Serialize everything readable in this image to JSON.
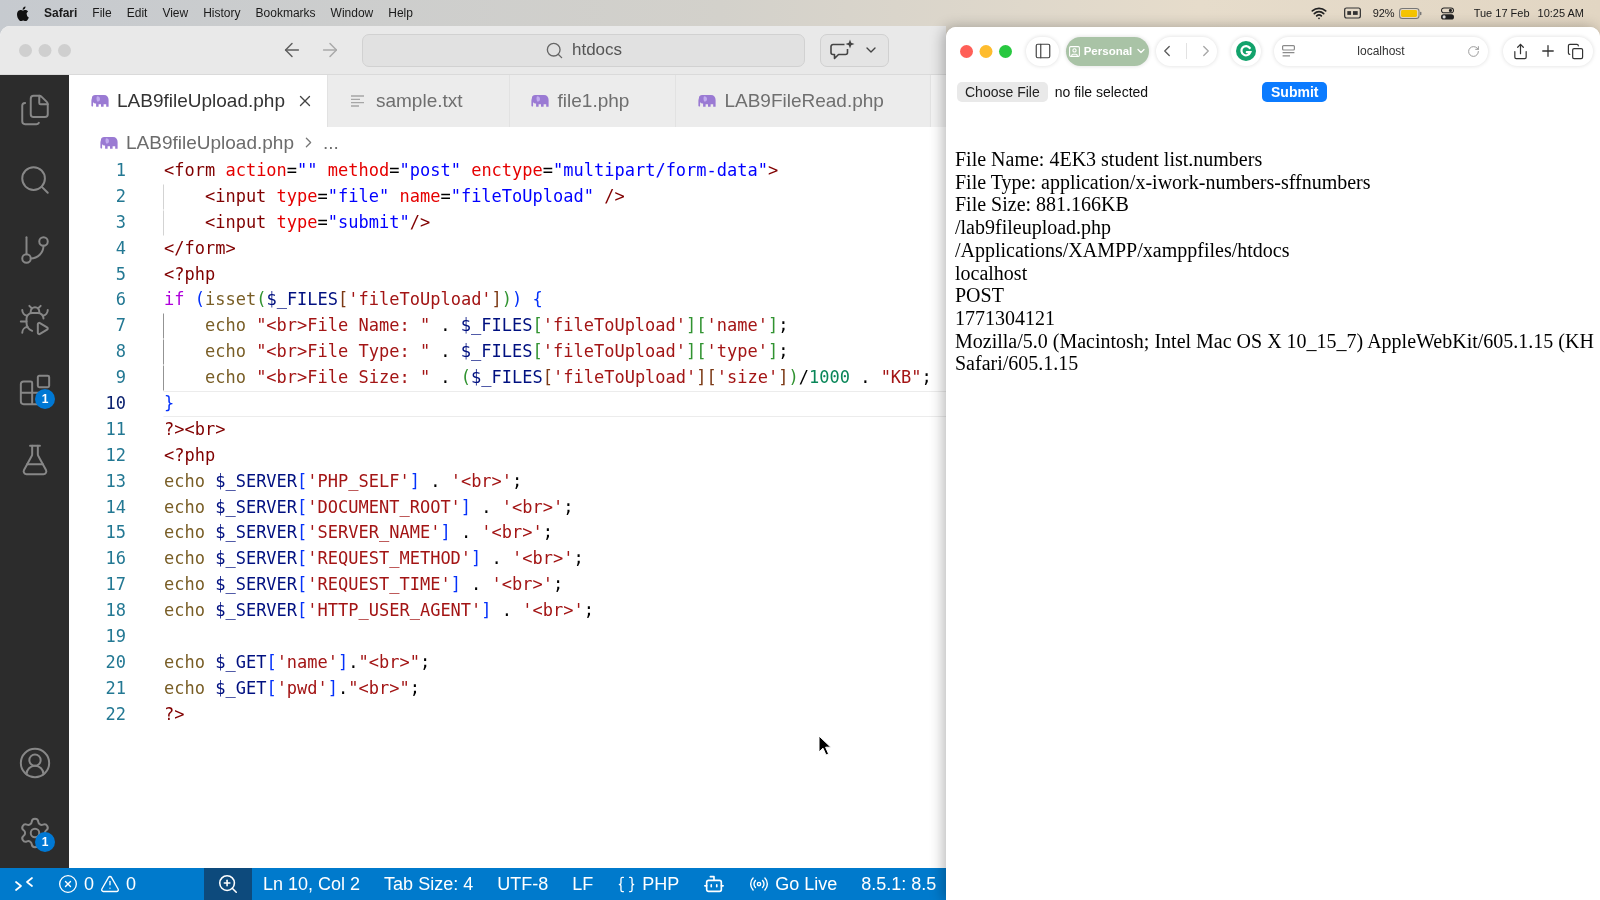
{
  "menu_bar": {
    "app_name": "Safari",
    "menus": [
      "File",
      "Edit",
      "View",
      "History",
      "Bookmarks",
      "Window",
      "Help"
    ],
    "battery_percent": "92%",
    "date": "Tue 17 Feb",
    "time": "10:25 AM"
  },
  "editor_window": {
    "active": false,
    "navigation": [
      {
        "kind": "back",
        "disabled": false
      },
      {
        "kind": "forward",
        "disabled": true
      }
    ],
    "command_center": {
      "label": "htdocs"
    },
    "activity_bar": {
      "top": [
        {
          "kind": "files"
        },
        {
          "kind": "search"
        },
        {
          "kind": "source-control"
        },
        {
          "kind": "run-debug"
        },
        {
          "kind": "extensions",
          "badge": "1"
        },
        {
          "kind": "testing"
        }
      ],
      "bottom": [
        {
          "kind": "account"
        },
        {
          "kind": "settings",
          "badge": "1"
        }
      ]
    },
    "tabs": [
      {
        "label": "LAB9fileUpload.php",
        "kind": "php",
        "selected": true
      },
      {
        "label": "sample.txt",
        "kind": "text",
        "selected": false
      },
      {
        "label": "file1.php",
        "kind": "php",
        "selected": false
      },
      {
        "label": "LAB9FileRead.php",
        "kind": "php",
        "selected": false
      }
    ],
    "breadcrumb": {
      "file": "LAB9fileUpload.php",
      "rest": "..."
    },
    "code_lines": [
      {
        "number": "1",
        "current": false,
        "guide": false,
        "tokens": [
          {
            "kind": "tag",
            "text": "<form"
          },
          {
            "kind": "attr",
            "text": " action"
          },
          {
            "kind": "plain",
            "text": "="
          },
          {
            "kind": "value",
            "text": "\"\""
          },
          {
            "kind": "attr",
            "text": " method"
          },
          {
            "kind": "plain",
            "text": "="
          },
          {
            "kind": "value",
            "text": "\"post\""
          },
          {
            "kind": "attr",
            "text": " enctype"
          },
          {
            "kind": "plain",
            "text": "="
          },
          {
            "kind": "value",
            "text": "\"multipart/form-data\""
          },
          {
            "kind": "tag",
            "text": ">"
          }
        ]
      },
      {
        "number": "2",
        "current": false,
        "guide": true,
        "guide_active": false,
        "tokens": [
          {
            "kind": "tag",
            "text": "    <input"
          },
          {
            "kind": "attr",
            "text": " type"
          },
          {
            "kind": "plain",
            "text": "="
          },
          {
            "kind": "value",
            "text": "\"file\""
          },
          {
            "kind": "attr",
            "text": " name"
          },
          {
            "kind": "plain",
            "text": "="
          },
          {
            "kind": "value",
            "text": "\"fileToUpload\""
          },
          {
            "kind": "tag",
            "text": " />"
          }
        ]
      },
      {
        "number": "3",
        "current": false,
        "guide": true,
        "guide_active": false,
        "tokens": [
          {
            "kind": "tag",
            "text": "    <input"
          },
          {
            "kind": "attr",
            "text": " type"
          },
          {
            "kind": "plain",
            "text": "="
          },
          {
            "kind": "value",
            "text": "\"submit\""
          },
          {
            "kind": "tag",
            "text": "/>"
          }
        ]
      },
      {
        "number": "4",
        "current": false,
        "guide": false,
        "tokens": [
          {
            "kind": "tag",
            "text": "</form>"
          }
        ]
      },
      {
        "number": "5",
        "current": false,
        "guide": false,
        "tokens": [
          {
            "kind": "tag",
            "text": "<?php"
          }
        ]
      },
      {
        "number": "6",
        "current": false,
        "guide": false,
        "tokens": [
          {
            "kind": "keyword",
            "text": "if "
          },
          {
            "kind": "bracket1",
            "text": "("
          },
          {
            "kind": "function",
            "text": "isset"
          },
          {
            "kind": "bracket2",
            "text": "("
          },
          {
            "kind": "variable",
            "text": "$_FILES"
          },
          {
            "kind": "bracket3",
            "text": "["
          },
          {
            "kind": "string",
            "text": "'fileToUpload'"
          },
          {
            "kind": "bracket3",
            "text": "]"
          },
          {
            "kind": "bracket2",
            "text": ")"
          },
          {
            "kind": "bracket1",
            "text": ") {"
          }
        ]
      },
      {
        "number": "7",
        "current": false,
        "guide": true,
        "guide_active": true,
        "tokens": [
          {
            "kind": "function",
            "text": "    echo "
          },
          {
            "kind": "string",
            "text": "\"<br>File Name: \""
          },
          {
            "kind": "plain",
            "text": " . "
          },
          {
            "kind": "variable",
            "text": "$_FILES"
          },
          {
            "kind": "bracket2",
            "text": "["
          },
          {
            "kind": "string",
            "text": "'fileToUpload'"
          },
          {
            "kind": "bracket2",
            "text": "]["
          },
          {
            "kind": "string",
            "text": "'name'"
          },
          {
            "kind": "bracket2",
            "text": "]"
          },
          {
            "kind": "plain",
            "text": ";"
          }
        ]
      },
      {
        "number": "8",
        "current": false,
        "guide": true,
        "guide_active": true,
        "tokens": [
          {
            "kind": "function",
            "text": "    echo "
          },
          {
            "kind": "string",
            "text": "\"<br>File Type: \""
          },
          {
            "kind": "plain",
            "text": " . "
          },
          {
            "kind": "variable",
            "text": "$_FILES"
          },
          {
            "kind": "bracket2",
            "text": "["
          },
          {
            "kind": "string",
            "text": "'fileToUpload'"
          },
          {
            "kind": "bracket2",
            "text": "]["
          },
          {
            "kind": "string",
            "text": "'type'"
          },
          {
            "kind": "bracket2",
            "text": "]"
          },
          {
            "kind": "plain",
            "text": ";"
          }
        ]
      },
      {
        "number": "9",
        "current": false,
        "guide": true,
        "guide_active": true,
        "tokens": [
          {
            "kind": "function",
            "text": "    echo "
          },
          {
            "kind": "string",
            "text": "\"<br>File Size: \""
          },
          {
            "kind": "plain",
            "text": " . "
          },
          {
            "kind": "bracket2",
            "text": "("
          },
          {
            "kind": "variable",
            "text": "$_FILES"
          },
          {
            "kind": "bracket3",
            "text": "["
          },
          {
            "kind": "string",
            "text": "'fileToUpload'"
          },
          {
            "kind": "bracket3",
            "text": "]["
          },
          {
            "kind": "string",
            "text": "'size'"
          },
          {
            "kind": "bracket3",
            "text": "]"
          },
          {
            "kind": "bracket2",
            "text": ")"
          },
          {
            "kind": "plain",
            "text": "/"
          },
          {
            "kind": "number",
            "text": "1000"
          },
          {
            "kind": "plain",
            "text": " . "
          },
          {
            "kind": "string",
            "text": "\"KB\""
          },
          {
            "kind": "plain",
            "text": ";"
          }
        ]
      },
      {
        "number": "10",
        "current": true,
        "guide": false,
        "tokens": [
          {
            "kind": "bracket1",
            "text": "}"
          }
        ]
      },
      {
        "number": "11",
        "current": false,
        "guide": false,
        "tokens": [
          {
            "kind": "tag",
            "text": "?><br>"
          }
        ]
      },
      {
        "number": "12",
        "current": false,
        "guide": false,
        "tokens": [
          {
            "kind": "tag",
            "text": "<?php"
          }
        ]
      },
      {
        "number": "13",
        "current": false,
        "guide": false,
        "tokens": [
          {
            "kind": "function",
            "text": "echo "
          },
          {
            "kind": "variable",
            "text": "$_SERVER"
          },
          {
            "kind": "bracket1",
            "text": "["
          },
          {
            "kind": "string",
            "text": "'PHP_SELF'"
          },
          {
            "kind": "bracket1",
            "text": "]"
          },
          {
            "kind": "plain",
            "text": " . "
          },
          {
            "kind": "string",
            "text": "'<br>'"
          },
          {
            "kind": "plain",
            "text": ";"
          }
        ]
      },
      {
        "number": "14",
        "current": false,
        "guide": false,
        "tokens": [
          {
            "kind": "function",
            "text": "echo "
          },
          {
            "kind": "variable",
            "text": "$_SERVER"
          },
          {
            "kind": "bracket1",
            "text": "["
          },
          {
            "kind": "string",
            "text": "'DOCUMENT_ROOT'"
          },
          {
            "kind": "bracket1",
            "text": "]"
          },
          {
            "kind": "plain",
            "text": " . "
          },
          {
            "kind": "string",
            "text": "'<br>'"
          },
          {
            "kind": "plain",
            "text": ";"
          }
        ]
      },
      {
        "number": "15",
        "current": false,
        "guide": false,
        "tokens": [
          {
            "kind": "function",
            "text": "echo "
          },
          {
            "kind": "variable",
            "text": "$_SERVER"
          },
          {
            "kind": "bracket1",
            "text": "["
          },
          {
            "kind": "string",
            "text": "'SERVER_NAME'"
          },
          {
            "kind": "bracket1",
            "text": "]"
          },
          {
            "kind": "plain",
            "text": " . "
          },
          {
            "kind": "string",
            "text": "'<br>'"
          },
          {
            "kind": "plain",
            "text": ";"
          }
        ]
      },
      {
        "number": "16",
        "current": false,
        "guide": false,
        "tokens": [
          {
            "kind": "function",
            "text": "echo "
          },
          {
            "kind": "variable",
            "text": "$_SERVER"
          },
          {
            "kind": "bracket1",
            "text": "["
          },
          {
            "kind": "string",
            "text": "'REQUEST_METHOD'"
          },
          {
            "kind": "bracket1",
            "text": "]"
          },
          {
            "kind": "plain",
            "text": " . "
          },
          {
            "kind": "string",
            "text": "'<br>'"
          },
          {
            "kind": "plain",
            "text": ";"
          }
        ]
      },
      {
        "number": "17",
        "current": false,
        "guide": false,
        "tokens": [
          {
            "kind": "function",
            "text": "echo "
          },
          {
            "kind": "variable",
            "text": "$_SERVER"
          },
          {
            "kind": "bracket1",
            "text": "["
          },
          {
            "kind": "string",
            "text": "'REQUEST_TIME'"
          },
          {
            "kind": "bracket1",
            "text": "]"
          },
          {
            "kind": "plain",
            "text": " . "
          },
          {
            "kind": "string",
            "text": "'<br>'"
          },
          {
            "kind": "plain",
            "text": ";"
          }
        ]
      },
      {
        "number": "18",
        "current": false,
        "guide": false,
        "tokens": [
          {
            "kind": "function",
            "text": "echo "
          },
          {
            "kind": "variable",
            "text": "$_SERVER"
          },
          {
            "kind": "bracket1",
            "text": "["
          },
          {
            "kind": "string",
            "text": "'HTTP_USER_AGENT'"
          },
          {
            "kind": "bracket1",
            "text": "]"
          },
          {
            "kind": "plain",
            "text": " . "
          },
          {
            "kind": "string",
            "text": "'<br>'"
          },
          {
            "kind": "plain",
            "text": ";"
          }
        ]
      },
      {
        "number": "19",
        "current": false,
        "guide": false
      },
      {
        "number": "20",
        "current": false,
        "guide": false,
        "tokens": [
          {
            "kind": "function",
            "text": "echo "
          },
          {
            "kind": "variable",
            "text": "$_GET"
          },
          {
            "kind": "bracket1",
            "text": "["
          },
          {
            "kind": "string",
            "text": "'name'"
          },
          {
            "kind": "bracket1",
            "text": "]"
          },
          {
            "kind": "plain",
            "text": "."
          },
          {
            "kind": "string",
            "text": "\"<br>\""
          },
          {
            "kind": "plain",
            "text": ";"
          }
        ]
      },
      {
        "number": "21",
        "current": false,
        "guide": false,
        "tokens": [
          {
            "kind": "function",
            "text": "echo "
          },
          {
            "kind": "variable",
            "text": "$_GET"
          },
          {
            "kind": "bracket1",
            "text": "["
          },
          {
            "kind": "string",
            "text": "'pwd'"
          },
          {
            "kind": "bracket1",
            "text": "]"
          },
          {
            "kind": "plain",
            "text": "."
          },
          {
            "kind": "string",
            "text": "\"<br>\""
          },
          {
            "kind": "plain",
            "text": ";"
          }
        ]
      },
      {
        "number": "22",
        "current": false,
        "guide": false,
        "tokens": [
          {
            "kind": "tag",
            "text": "?>"
          }
        ]
      }
    ],
    "status_bar": [
      {
        "kind": "remote"
      },
      {
        "kind": "problems",
        "errors": "0",
        "warnings": "0"
      },
      {
        "kind": "zoom"
      },
      {
        "kind": "text",
        "label": "Ln 10, Col 2"
      },
      {
        "kind": "text",
        "label": "Tab Size: 4"
      },
      {
        "kind": "text",
        "label": "UTF-8"
      },
      {
        "kind": "text",
        "label": "LF"
      },
      {
        "kind": "language",
        "label": "PHP"
      },
      {
        "kind": "copilot"
      },
      {
        "kind": "live",
        "label": "Go Live"
      },
      {
        "kind": "text",
        "label": "8.5.1: 8.5"
      }
    ]
  },
  "browser_window": {
    "active": true,
    "navigation": [
      {
        "kind": "back",
        "disabled": false
      },
      {
        "kind": "forward",
        "disabled": true
      }
    ],
    "profile": {
      "label": "Personal"
    },
    "address": "localhost",
    "page": {
      "file_button": "Choose File",
      "file_status": "no file selected",
      "submit_button": "Submit",
      "output_lines": [
        "File Name: 4EK3 student list.numbers",
        "File Type: application/x-iwork-numbers-sffnumbers",
        "File Size: 881.166KB",
        "/lab9fileupload.php",
        "/Applications/XAMPP/xamppfiles/htdocs",
        "localhost",
        "POST",
        "1771304121",
        "Mozilla/5.0 (Macintosh; Intel Mac OS X 10_15_7) AppleWebKit/605.1.15 (KH",
        "Safari/605.1.15"
      ]
    }
  }
}
